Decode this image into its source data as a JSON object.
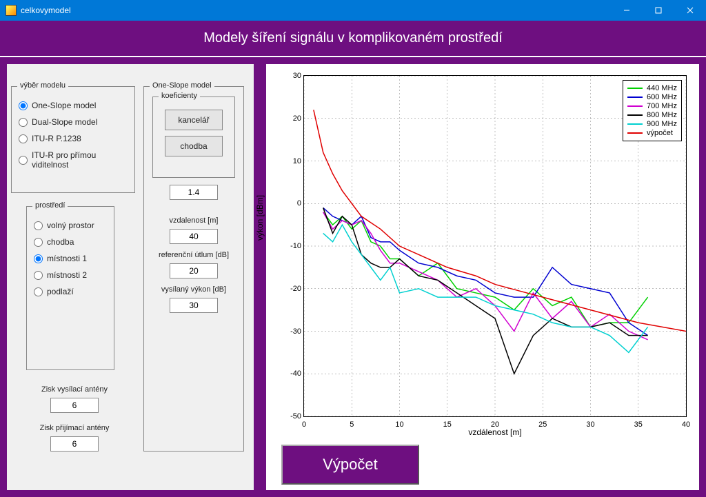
{
  "window_title": "celkovymodel",
  "banner_title": "Modely šíření signálu v komplikovaném prostředí",
  "model_group": {
    "legend": "výběr modelu",
    "options": [
      {
        "label": "One-Slope model"
      },
      {
        "label": "Dual-Slope model"
      },
      {
        "label": "ITU-R P.1238"
      },
      {
        "label": "ITU-R pro přímou viditelnost"
      }
    ],
    "selected": "One-Slope model"
  },
  "env_group": {
    "legend": "prostředí",
    "options": [
      {
        "label": "volný prostor"
      },
      {
        "label": "chodba"
      },
      {
        "label": "místnosti 1"
      },
      {
        "label": "místnosti 2"
      },
      {
        "label": "podlaží"
      }
    ],
    "selected": "místnosti 1"
  },
  "tx_gain_label": "Zisk vysílací antény",
  "tx_gain_value": "6",
  "rx_gain_label": "Zisk přijímací antény",
  "rx_gain_value": "6",
  "oneslope_group": {
    "legend": "One-Slope model",
    "coef_legend": "koeficienty",
    "btn_office": "kancelář",
    "btn_corridor": "chodba",
    "coef_value": "1.4",
    "dist_label": "vzdalenost [m]",
    "dist_value": "40",
    "refatt_label": "referenční útlum [dB]",
    "refatt_value": "20",
    "txpow_label": "vysílaný výkon [dB]",
    "txpow_value": "30"
  },
  "big_button": "Výpočet",
  "chart_data": {
    "type": "line",
    "xlabel": "vzdálenost [m]",
    "ylabel": "výkon [dBm]",
    "xlim": [
      0,
      40
    ],
    "ylim": [
      -50,
      30
    ],
    "xticks": [
      0,
      5,
      10,
      15,
      20,
      25,
      30,
      35,
      40
    ],
    "yticks": [
      -50,
      -40,
      -30,
      -20,
      -10,
      0,
      10,
      20,
      30
    ],
    "series": [
      {
        "name": "440 MHz",
        "color": "#00d000",
        "x": [
          2,
          3,
          4,
          5,
          6,
          7,
          8,
          9,
          10,
          12,
          14,
          16,
          18,
          20,
          22,
          24,
          26,
          28,
          30,
          32,
          34,
          36
        ],
        "y": [
          -2,
          -5,
          -3,
          -6,
          -4,
          -9,
          -10,
          -13,
          -13,
          -17,
          -14,
          -20,
          -21,
          -22,
          -25,
          -20,
          -24,
          -22,
          -29,
          -28,
          -28,
          -22
        ]
      },
      {
        "name": "600 MHz",
        "color": "#0000d0",
        "x": [
          2,
          3,
          4,
          5,
          6,
          7,
          8,
          9,
          10,
          12,
          14,
          16,
          18,
          20,
          22,
          24,
          26,
          28,
          30,
          32,
          34,
          36
        ],
        "y": [
          -1,
          -3,
          -4,
          -5,
          -3,
          -8,
          -9,
          -9,
          -11,
          -14,
          -15,
          -17,
          -18,
          -21,
          -22,
          -22,
          -15,
          -19,
          -20,
          -21,
          -28,
          -31
        ]
      },
      {
        "name": "700 MHz",
        "color": "#d000d0",
        "x": [
          2,
          3,
          4,
          5,
          6,
          7,
          8,
          9,
          10,
          12,
          14,
          16,
          18,
          20,
          22,
          24,
          26,
          28,
          30,
          32,
          34,
          36
        ],
        "y": [
          -2,
          -6,
          -4,
          -5,
          -4,
          -7,
          -11,
          -14,
          -14,
          -16,
          -18,
          -22,
          -20,
          -24,
          -30,
          -21,
          -27,
          -23,
          -29,
          -26,
          -30,
          -32
        ]
      },
      {
        "name": "800 MHz",
        "color": "#000000",
        "x": [
          2,
          3,
          4,
          5,
          6,
          7,
          8,
          9,
          10,
          12,
          14,
          16,
          18,
          20,
          22,
          24,
          26,
          28,
          30,
          32,
          34,
          36
        ],
        "y": [
          -1,
          -7,
          -3,
          -5,
          -12,
          -14,
          -15,
          -15,
          -13,
          -17,
          -18,
          -21,
          -24,
          -27,
          -40,
          -31,
          -27,
          -29,
          -29,
          -28,
          -31,
          -31
        ]
      },
      {
        "name": "900 MHz",
        "color": "#00d0d0",
        "x": [
          2,
          3,
          4,
          5,
          6,
          7,
          8,
          9,
          10,
          12,
          14,
          16,
          18,
          20,
          22,
          24,
          26,
          28,
          30,
          32,
          34,
          36
        ],
        "y": [
          -7,
          -9,
          -5,
          -9,
          -12,
          -15,
          -18,
          -15,
          -21,
          -20,
          -22,
          -22,
          -22,
          -24,
          -25,
          -26,
          -28,
          -29,
          -29,
          -31,
          -35,
          -29
        ]
      },
      {
        "name": "výpočet",
        "color": "#e00000",
        "x": [
          1,
          2,
          3,
          4,
          5,
          6,
          8,
          10,
          12,
          15,
          18,
          20,
          25,
          30,
          35,
          40
        ],
        "y": [
          22,
          12,
          7,
          3,
          0,
          -3,
          -6,
          -10,
          -12,
          -15,
          -17,
          -19,
          -22,
          -25,
          -28,
          -30
        ]
      }
    ]
  },
  "colors": {
    "brand": "#6e0f80",
    "titlebar": "#0078d7"
  }
}
